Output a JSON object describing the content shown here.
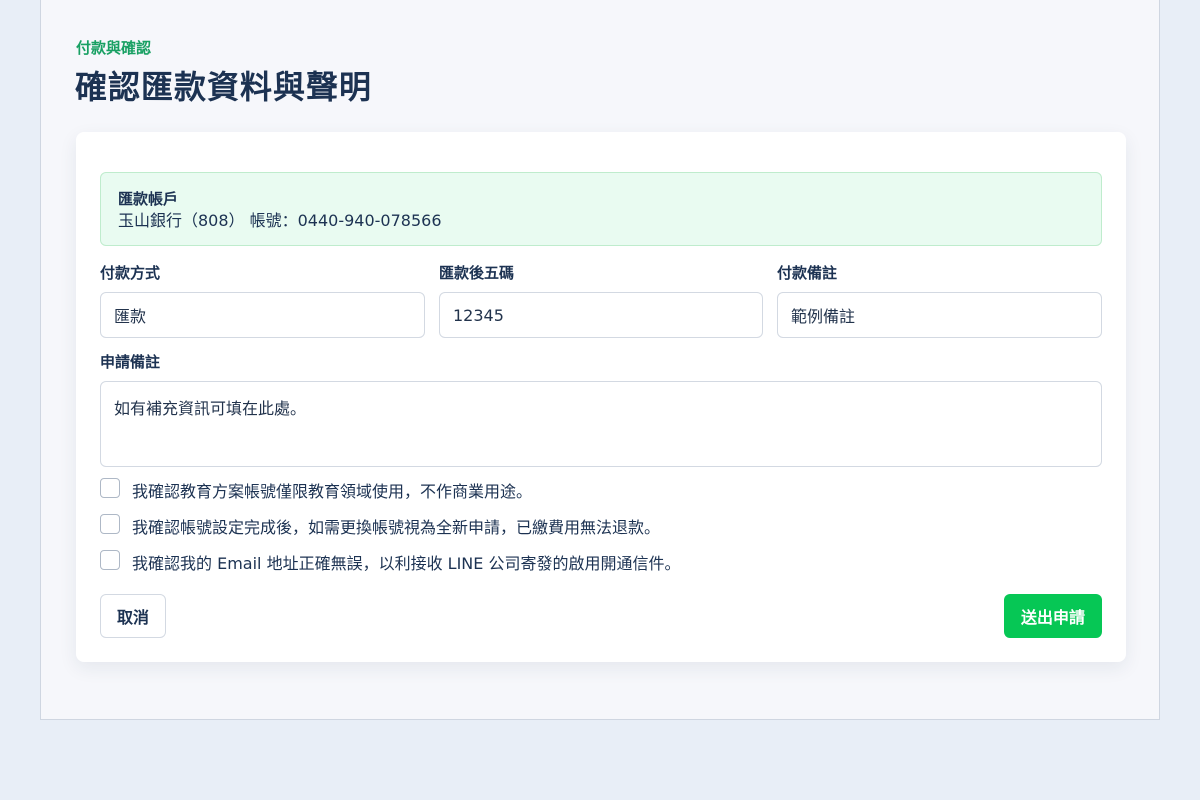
{
  "header": {
    "eyebrow": "付款與確認",
    "title": "確認匯款資料與聲明"
  },
  "account": {
    "title": "匯款帳戶",
    "detail": "玉山銀行（808） 帳號：0440-940-078566"
  },
  "fields": {
    "payment_method": {
      "label": "付款方式",
      "value": "匯款"
    },
    "last_five": {
      "label": "匯款後五碼",
      "value": "12345"
    },
    "payment_note": {
      "label": "付款備註",
      "value": "範例備註"
    },
    "application_note": {
      "label": "申請備註",
      "value": "如有補充資訊可填在此處。"
    }
  },
  "checks": [
    {
      "label": "我確認教育方案帳號僅限教育領域使用，不作商業用途。",
      "checked": false
    },
    {
      "label": "我確認帳號設定完成後，如需更換帳號視為全新申請，已繳費用無法退款。",
      "checked": false
    },
    {
      "label": "我確認我的 Email 地址正確無誤，以利接收 LINE 公司寄發的啟用開通信件。",
      "checked": false
    }
  ],
  "actions": {
    "cancel": "取消",
    "submit": "送出申請"
  },
  "colors": {
    "accent": "#06c755",
    "eyebrow": "#18a063",
    "text": "#1c3252",
    "notice_bg": "#e9fbf1"
  }
}
